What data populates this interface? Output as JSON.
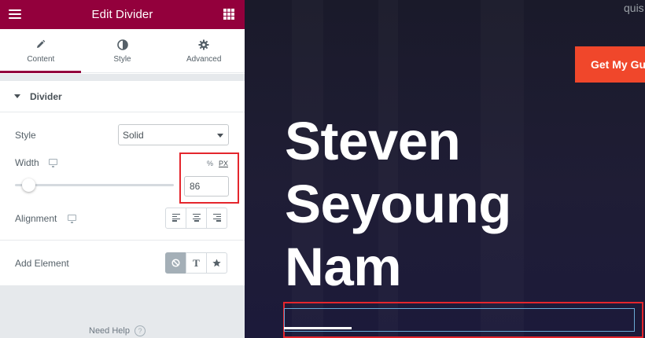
{
  "editor": {
    "title": "Edit Divider",
    "tabs": [
      {
        "label": "Content",
        "icon": "pencil-icon"
      },
      {
        "label": "Style",
        "icon": "half-circle-icon"
      },
      {
        "label": "Advanced",
        "icon": "gear-icon"
      }
    ],
    "active_tab": "Content",
    "section_title": "Divider",
    "style": {
      "label": "Style",
      "value": "Solid"
    },
    "width": {
      "label": "Width",
      "units": [
        "%",
        "PX"
      ],
      "selected_unit": "PX",
      "value": "86",
      "slider_fraction": 0.086
    },
    "alignment": {
      "label": "Alignment",
      "options": [
        "left",
        "center",
        "right"
      ]
    },
    "add_element": {
      "label": "Add Element",
      "options": [
        "none",
        "text",
        "icon"
      ],
      "selected": "none",
      "text_glyph": "T"
    },
    "help_label": "Need Help",
    "help_glyph": "?"
  },
  "preview": {
    "top_text": "quis",
    "cta_label": "Get My Gu",
    "heading_lines": [
      "Steven",
      "Seyoung",
      "Nam"
    ]
  },
  "colors": {
    "brand": "#93003c",
    "cta": "#f0472b",
    "highlight": "#e4262d",
    "preview_bg": "#1d1c30"
  }
}
